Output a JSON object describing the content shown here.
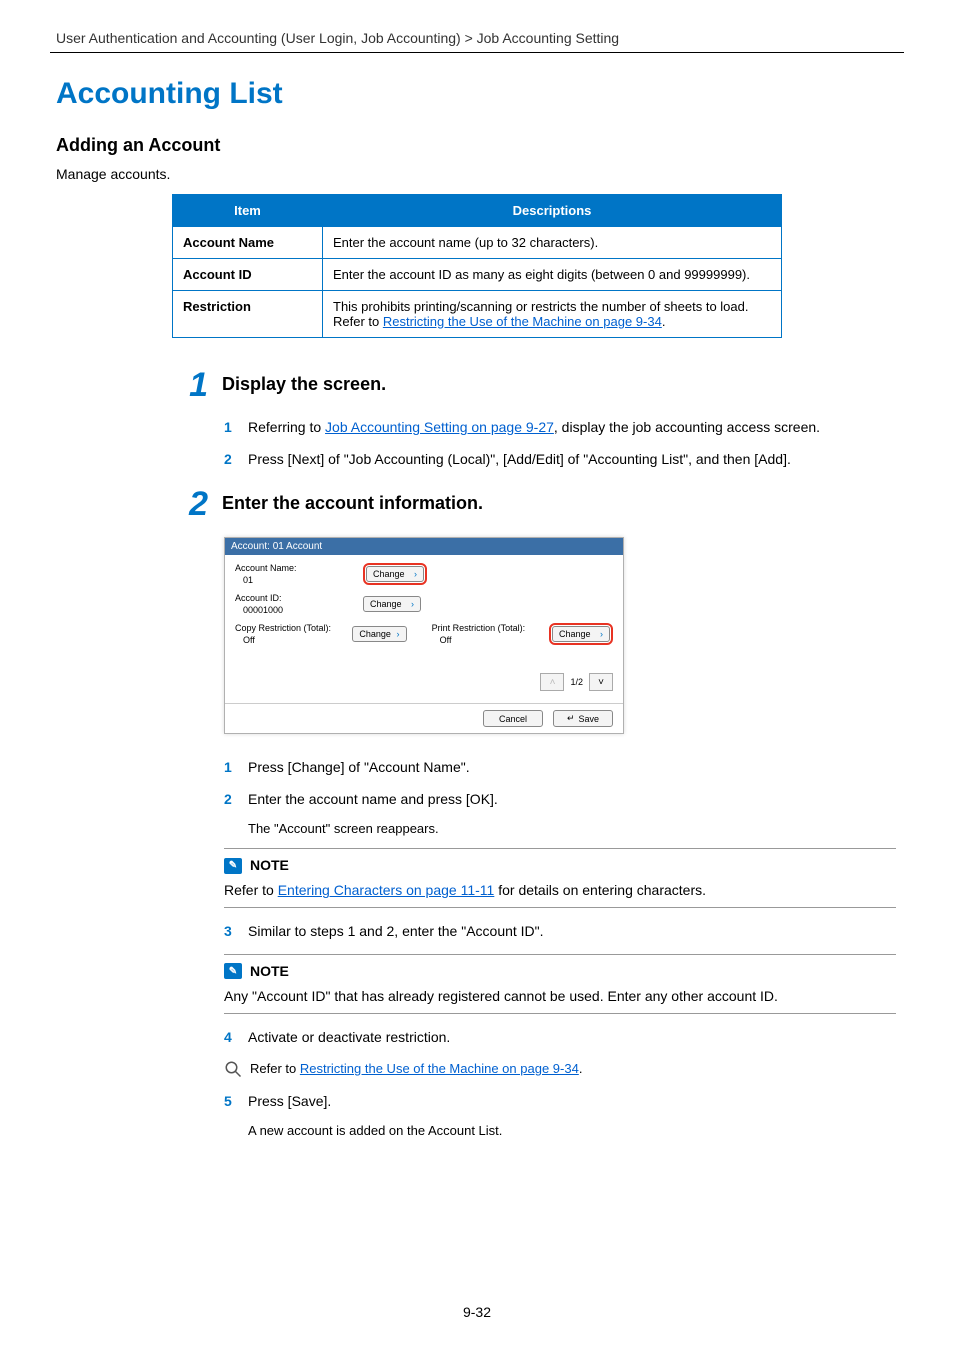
{
  "breadcrumb": "User Authentication and Accounting (User Login, Job Accounting) > Job Accounting Setting",
  "title": "Accounting List",
  "subtitle": "Adding an Account",
  "intro": "Manage accounts.",
  "table": {
    "headers": [
      "Item",
      "Descriptions"
    ],
    "rows": [
      {
        "item": "Account Name",
        "desc": "Enter the account name (up to 32 characters)."
      },
      {
        "item": "Account ID",
        "desc": "Enter the account ID as many as eight digits (between 0 and 99999999)."
      },
      {
        "item": "Restriction",
        "desc_pre": "This prohibits printing/scanning or restricts the number of sheets to load. Refer to ",
        "desc_link": "Restricting the Use of the Machine on page 9-34",
        "desc_post": "."
      }
    ]
  },
  "steps": [
    {
      "num": "1",
      "label": "Display the screen.",
      "sub": [
        {
          "n": "1",
          "pre": "Referring to ",
          "link": "Job Accounting Setting on page 9-27",
          "post": ", display the job accounting access screen."
        },
        {
          "n": "2",
          "text": "Press [Next] of \"Job Accounting (Local)\", [Add/Edit] of \"Accounting List\", and then [Add]."
        }
      ]
    },
    {
      "num": "2",
      "label": "Enter the account information.",
      "sub_after": [
        {
          "n": "1",
          "text": "Press [Change] of \"Account Name\"."
        },
        {
          "n": "2",
          "text": "Enter the account name and press [OK].",
          "note_after": "The \"Account\" screen reappears."
        },
        {
          "n": "3",
          "text": "Similar to steps 1 and 2, enter the \"Account ID\"."
        },
        {
          "n": "4",
          "text": "Activate or deactivate restriction."
        },
        {
          "n": "5",
          "text": "Press [Save].",
          "note_after": "A new account is added on the Account List."
        }
      ]
    }
  ],
  "ui": {
    "title": "Account: 01 Account",
    "account_name_label": "Account Name:",
    "account_name_value": "01",
    "account_id_label": "Account ID:",
    "account_id_value": "00001000",
    "copy_restr_label": "Copy Restriction (Total):",
    "copy_restr_value": "Off",
    "print_restr_label": "Print Restriction (Total):",
    "print_restr_value": "Off",
    "change_label": "Change",
    "page_indicator": "1/2",
    "cancel": "Cancel",
    "save": "Save"
  },
  "notes": {
    "label": "NOTE",
    "note1_pre": "Refer to ",
    "note1_link": "Entering Characters on page 11-11",
    "note1_post": " for details on entering characters.",
    "note2": "Any \"Account ID\" that has already registered cannot be used. Enter any other account ID."
  },
  "ref": {
    "pre": "Refer to ",
    "link": "Restricting the Use of the Machine on page 9-34",
    "post": "."
  },
  "page_number": "9-32"
}
